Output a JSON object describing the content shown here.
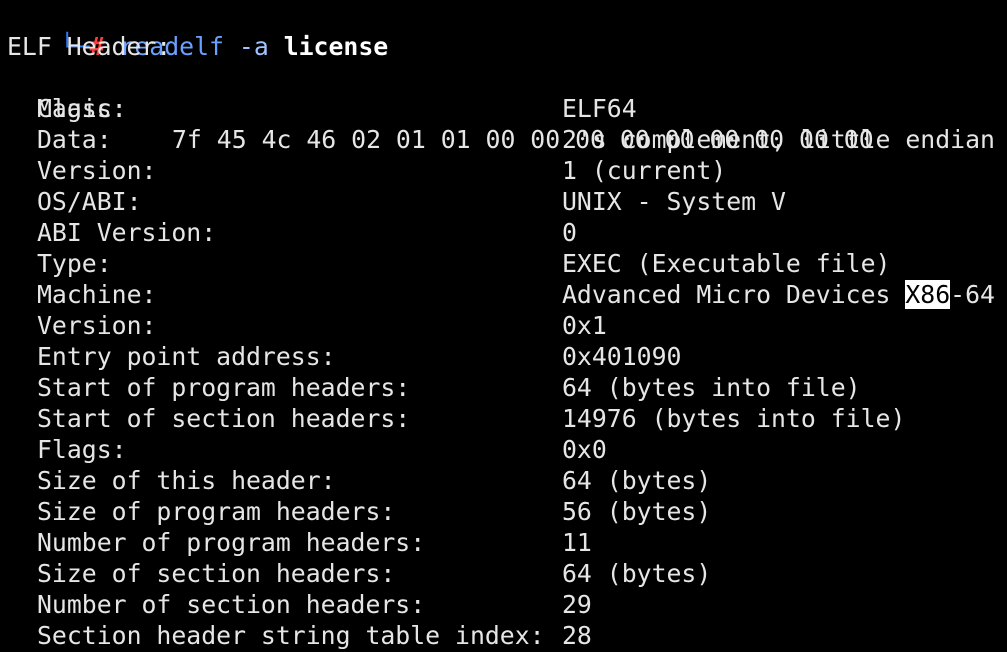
{
  "prompt": {
    "corner": "└─",
    "hash": "#",
    "command": "readelf",
    "option": "-a",
    "file": "license"
  },
  "header_title": "ELF Header:",
  "magic": {
    "label": "Magic:",
    "bytes": "7f 45 4c 46 02 01 01 00 00 00 00 00 00 00 00 00"
  },
  "rows": [
    {
      "label": "Class:",
      "value": "ELF64"
    },
    {
      "label": "Data:",
      "value": "2's complement, little endian"
    },
    {
      "label": "Version:",
      "value": "1 (current)"
    },
    {
      "label": "OS/ABI:",
      "value": "UNIX - System V"
    },
    {
      "label": "ABI Version:",
      "value": "0"
    },
    {
      "label": "Type:",
      "value": "EXEC (Executable file)"
    },
    {
      "label": "Machine:",
      "value_prefix": "Advanced Micro Devices ",
      "value_highlight": "X86",
      "value_suffix": "-64"
    },
    {
      "label": "Version:",
      "value": "0x1"
    },
    {
      "label": "Entry point address:",
      "value": "0x401090"
    },
    {
      "label": "Start of program headers:",
      "value": "64 (bytes into file)"
    },
    {
      "label": "Start of section headers:",
      "value": "14976 (bytes into file)"
    },
    {
      "label": "Flags:",
      "value": "0x0"
    },
    {
      "label": "Size of this header:",
      "value": "64 (bytes)"
    },
    {
      "label": "Size of program headers:",
      "value": "56 (bytes)"
    },
    {
      "label": "Number of program headers:",
      "value": "11"
    },
    {
      "label": "Size of section headers:",
      "value": "64 (bytes)"
    },
    {
      "label": "Number of section headers:",
      "value": "29"
    },
    {
      "label": "Section header string table index:",
      "value": "28"
    }
  ],
  "colors": {
    "background": "#000000",
    "text": "#e6e6e6",
    "prompt_hash": "#ff3b3b",
    "command": "#6aa0ff",
    "highlight_bg": "#ffffff"
  }
}
